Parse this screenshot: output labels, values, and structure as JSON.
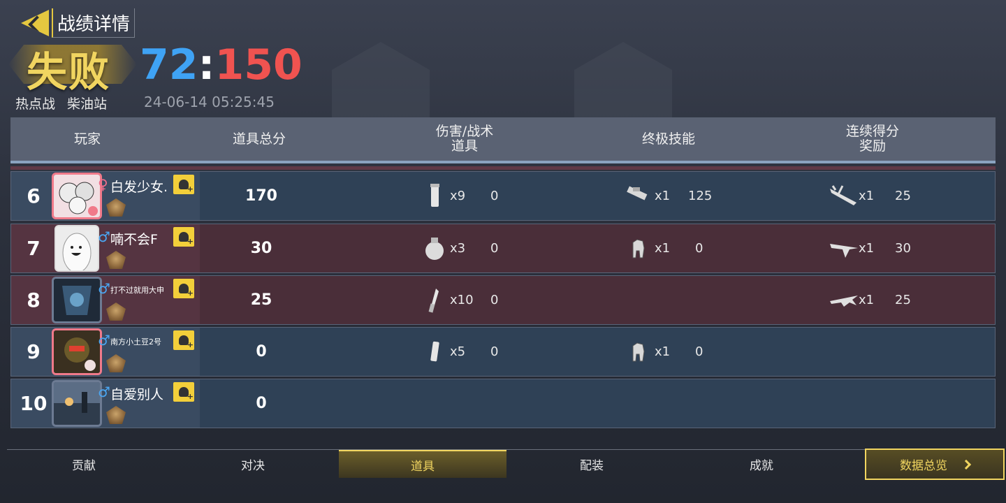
{
  "header": {
    "title": "战绩详情",
    "result": "失败",
    "score_blue": "72",
    "score_sep": ":",
    "score_red": "150",
    "mode": "热点战",
    "map": "柴油站",
    "datetime": "24-06-14 05:25:45"
  },
  "columns": {
    "player": "玩家",
    "total": "道具总分",
    "damage": "伤害/战术\n道具",
    "ultimate": "终极技能",
    "streak": "连续得分\n奖励"
  },
  "rows": [
    {
      "rank": "6",
      "name": "白发少女.",
      "gender": "♀",
      "total": "170",
      "damage_count": "x9",
      "damage_val": "0",
      "ult_count": "x1",
      "ult_val": "125",
      "streak_count": "x1",
      "streak_val": "25"
    },
    {
      "rank": "7",
      "name": "喃不会F",
      "gender": "♂",
      "total": "30",
      "damage_count": "x3",
      "damage_val": "0",
      "ult_count": "x1",
      "ult_val": "0",
      "streak_count": "x1",
      "streak_val": "30"
    },
    {
      "rank": "8",
      "name": "打不过就用大申",
      "gender": "♂",
      "total": "25",
      "damage_count": "x10",
      "damage_val": "0",
      "streak_count": "x1",
      "streak_val": "25"
    },
    {
      "rank": "9",
      "name": "南方小土豆2号",
      "gender": "♂",
      "total": "0",
      "damage_count": "x5",
      "damage_val": "0",
      "ult_count": "x1",
      "ult_val": "0"
    },
    {
      "rank": "10",
      "name": "自爱别人",
      "gender": "♂",
      "total": "0"
    }
  ],
  "tabs": [
    "贡献",
    "对决",
    "道具",
    "配装",
    "成就"
  ],
  "active_tab": "道具",
  "summary_button": "数据总览",
  "colors": {
    "accent": "#f1d560",
    "team_blue": "#3fa3f5",
    "team_red": "#f05350"
  }
}
